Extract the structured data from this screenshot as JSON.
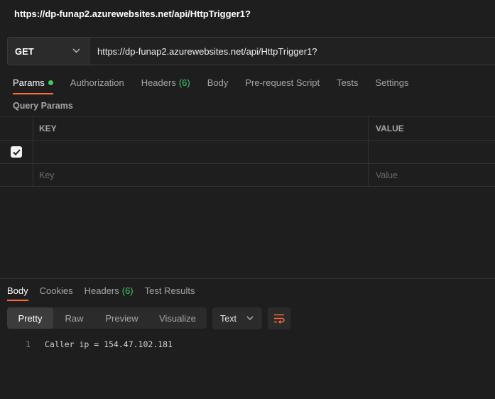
{
  "title": "https://dp-funap2.azurewebsites.net/api/HttpTrigger1?",
  "request": {
    "method": "GET",
    "url": "https://dp-funap2.azurewebsites.net/api/HttpTrigger1?"
  },
  "request_tabs": [
    {
      "label": "Params",
      "active": true,
      "indicator": "dot"
    },
    {
      "label": "Authorization"
    },
    {
      "label": "Headers",
      "count": "(6)"
    },
    {
      "label": "Body"
    },
    {
      "label": "Pre-request Script"
    },
    {
      "label": "Tests"
    },
    {
      "label": "Settings"
    }
  ],
  "query_params": {
    "section_label": "Query Params",
    "columns": {
      "key": "KEY",
      "value": "VALUE"
    },
    "placeholder": {
      "key": "Key",
      "value": "Value"
    }
  },
  "response": {
    "tabs": [
      {
        "label": "Body",
        "active": true
      },
      {
        "label": "Cookies"
      },
      {
        "label": "Headers",
        "count": "(6)"
      },
      {
        "label": "Test Results"
      }
    ],
    "views": [
      "Pretty",
      "Raw",
      "Preview",
      "Visualize"
    ],
    "format": "Text",
    "lines": [
      {
        "number": "1",
        "text": "Caller ip = 154.47.102.181"
      }
    ]
  },
  "colors": {
    "accent": "#ff6c37",
    "success": "#3ecb64",
    "background": "#1e1e1e"
  },
  "icons": [
    "chevron-down-icon",
    "check-icon",
    "wrap-lines-icon"
  ]
}
